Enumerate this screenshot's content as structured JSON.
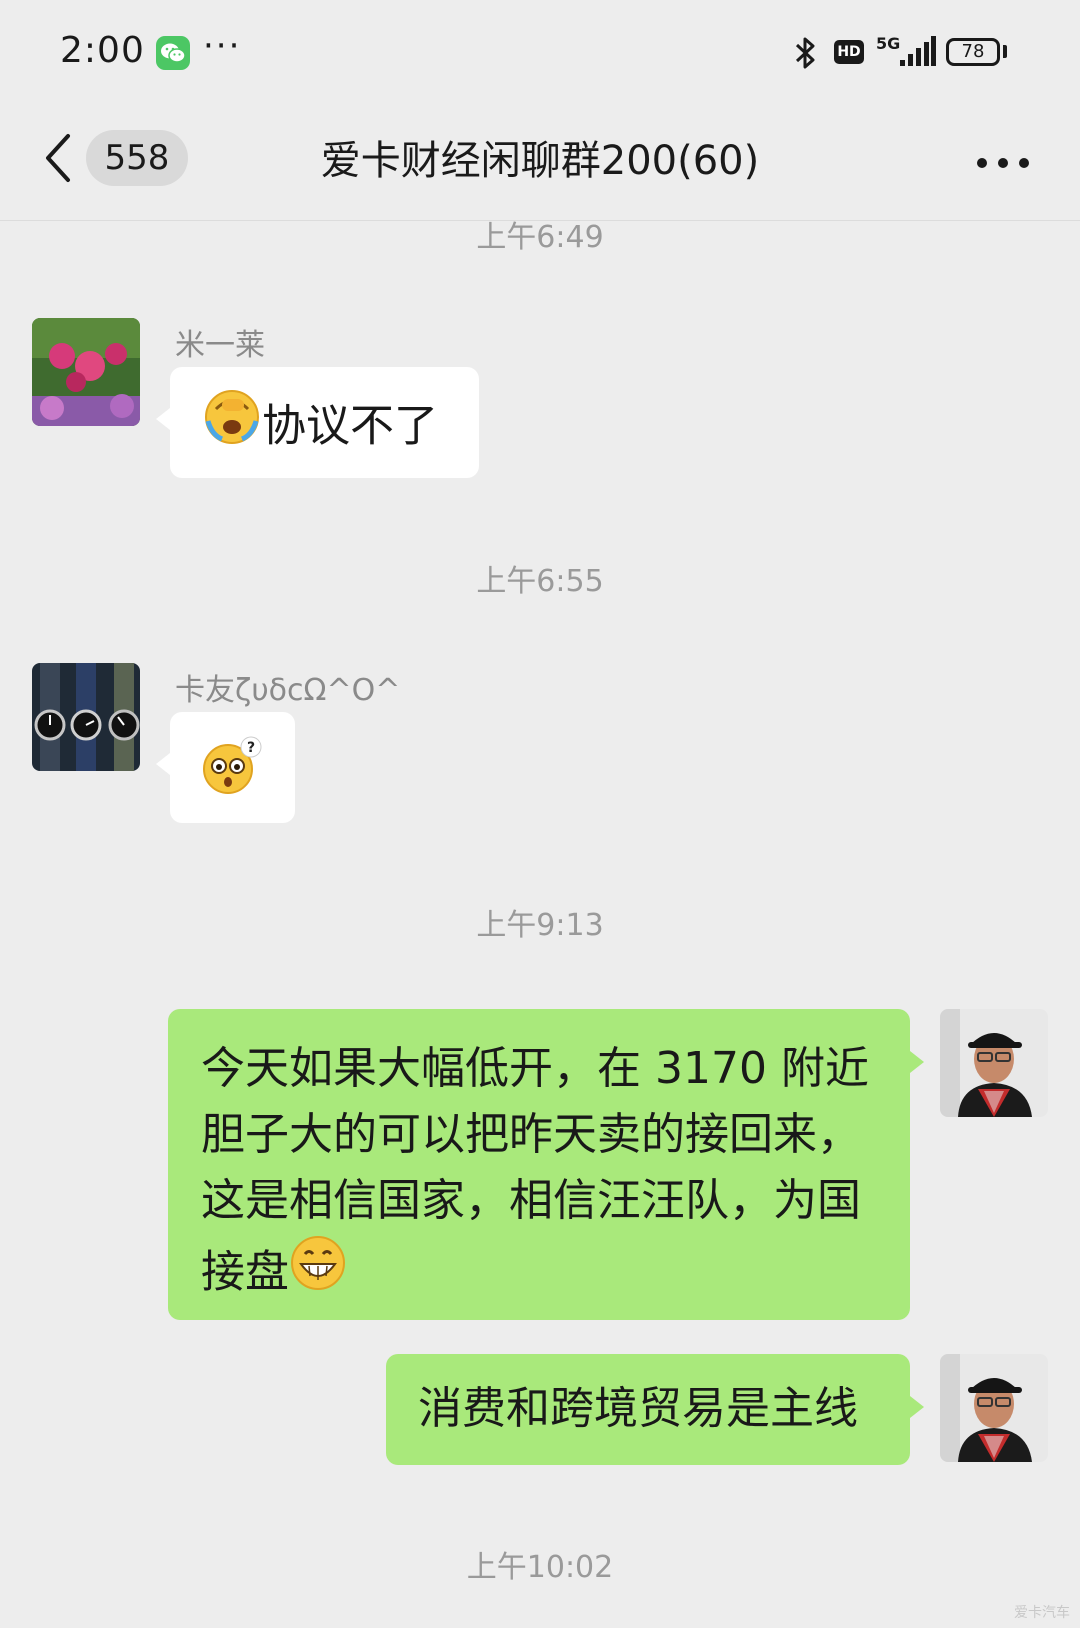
{
  "status_bar": {
    "time": "2:00",
    "notification_icon": "wechat-icon",
    "overflow": "···",
    "hd": "HD",
    "network": "5G",
    "battery": "78"
  },
  "nav": {
    "back_icon": "chevron-left-icon",
    "unread_count": "558",
    "title": "爱卡财经闲聊群200(60)",
    "more_icon": "more-dots-icon"
  },
  "messages": [
    {
      "type": "time",
      "text": "上午6:49"
    },
    {
      "type": "in",
      "sender": "米一莱",
      "avatar": "flowers-avatar",
      "text": "协议不了",
      "emoji": "facepalm-crying-emoji"
    },
    {
      "type": "time",
      "text": "上午6:55"
    },
    {
      "type": "in",
      "sender": "卡友ζυδcΩ^O^",
      "avatar": "watches-avatar",
      "text": "",
      "emoji": "confused-question-emoji"
    },
    {
      "type": "time",
      "text": "上午9:13"
    },
    {
      "type": "out",
      "avatar": "man-cap-avatar",
      "lines": [
        "今天如果大幅低开，在 3170 附近",
        "胆子大的可以把昨天卖的接回来，",
        "这是相信国家，相信汪汪队，为国",
        "接盘"
      ],
      "emoji": "grin-emoji"
    },
    {
      "type": "out",
      "avatar": "man-cap-avatar",
      "text": "消费和跨境贸易是主线"
    },
    {
      "type": "time",
      "text": "上午10:02"
    }
  ],
  "watermark": "爱卡汽车"
}
